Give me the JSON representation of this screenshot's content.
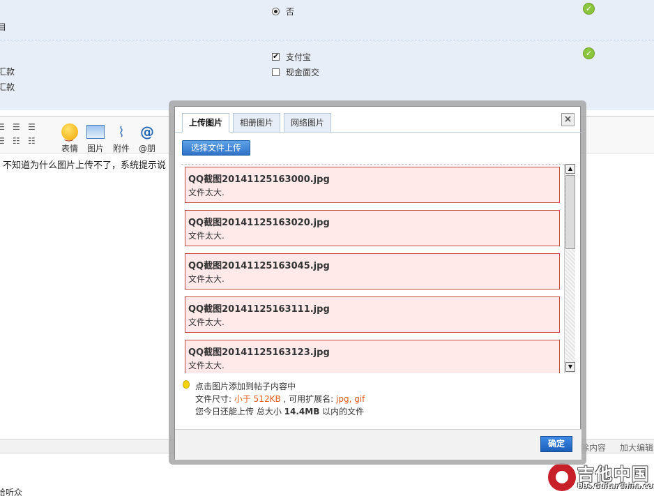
{
  "form": {
    "row1": {
      "cut_label": "目",
      "option_no": "否"
    },
    "row2": {
      "cut_label_1": "汇款",
      "cut_label_2": "汇款",
      "option_alipay": "支付宝",
      "option_cash": "现金面交"
    }
  },
  "toolbar": {
    "emoji_label": "表情",
    "image_label": "图片",
    "attach_label": "附件",
    "mention_label": "@朋",
    "mention_icon": "@"
  },
  "editor": {
    "content": "不知道为什么图片上传不了，系统提示说"
  },
  "bottom_bar": {
    "clear_link": "除内容",
    "enlarge_link": "加大编辑"
  },
  "bottom_text": "给听众",
  "watermark": {
    "title": "吉他中国",
    "url": "bbs.GuitarChina.com"
  },
  "dialog": {
    "tabs": [
      "上传图片",
      "相册图片",
      "网络图片"
    ],
    "close_icon": "×",
    "upload_button": "选择文件上传",
    "files": [
      {
        "name": "QQ截图20141125163000.jpg",
        "error": "文件太大."
      },
      {
        "name": "QQ截图20141125163020.jpg",
        "error": "文件太大."
      },
      {
        "name": "QQ截图20141125163045.jpg",
        "error": "文件太大."
      },
      {
        "name": "QQ截图20141125163111.jpg",
        "error": "文件太大."
      },
      {
        "name": "QQ截图20141125163123.jpg",
        "error": "文件太大."
      }
    ],
    "tips": {
      "line1": "点击图片添加到帖子内容中",
      "size_prefix": "文件尺寸: ",
      "size_value": "小于 512KB",
      "ext_prefix": " , 可用扩展名: ",
      "ext_value": "jpg, gif",
      "quota_prefix": "您今日还能上传 总大小 ",
      "quota_value": "14.4MB",
      "quota_suffix": " 以内的文件"
    },
    "confirm_button": "确定"
  },
  "colors": {
    "form_bg": "#e8eef7",
    "error_bg": "#ffe9e9",
    "error_border": "#c74747",
    "highlight": "#e05a1c",
    "primary": "#2e72c8"
  },
  "icons": [
    "check-circle-icon",
    "radio-icon",
    "checkbox-icon",
    "emoji-icon",
    "image-icon",
    "paperclip-icon",
    "at-icon",
    "close-icon",
    "lightbulb-icon",
    "scroll-up-icon",
    "scroll-down-icon"
  ]
}
